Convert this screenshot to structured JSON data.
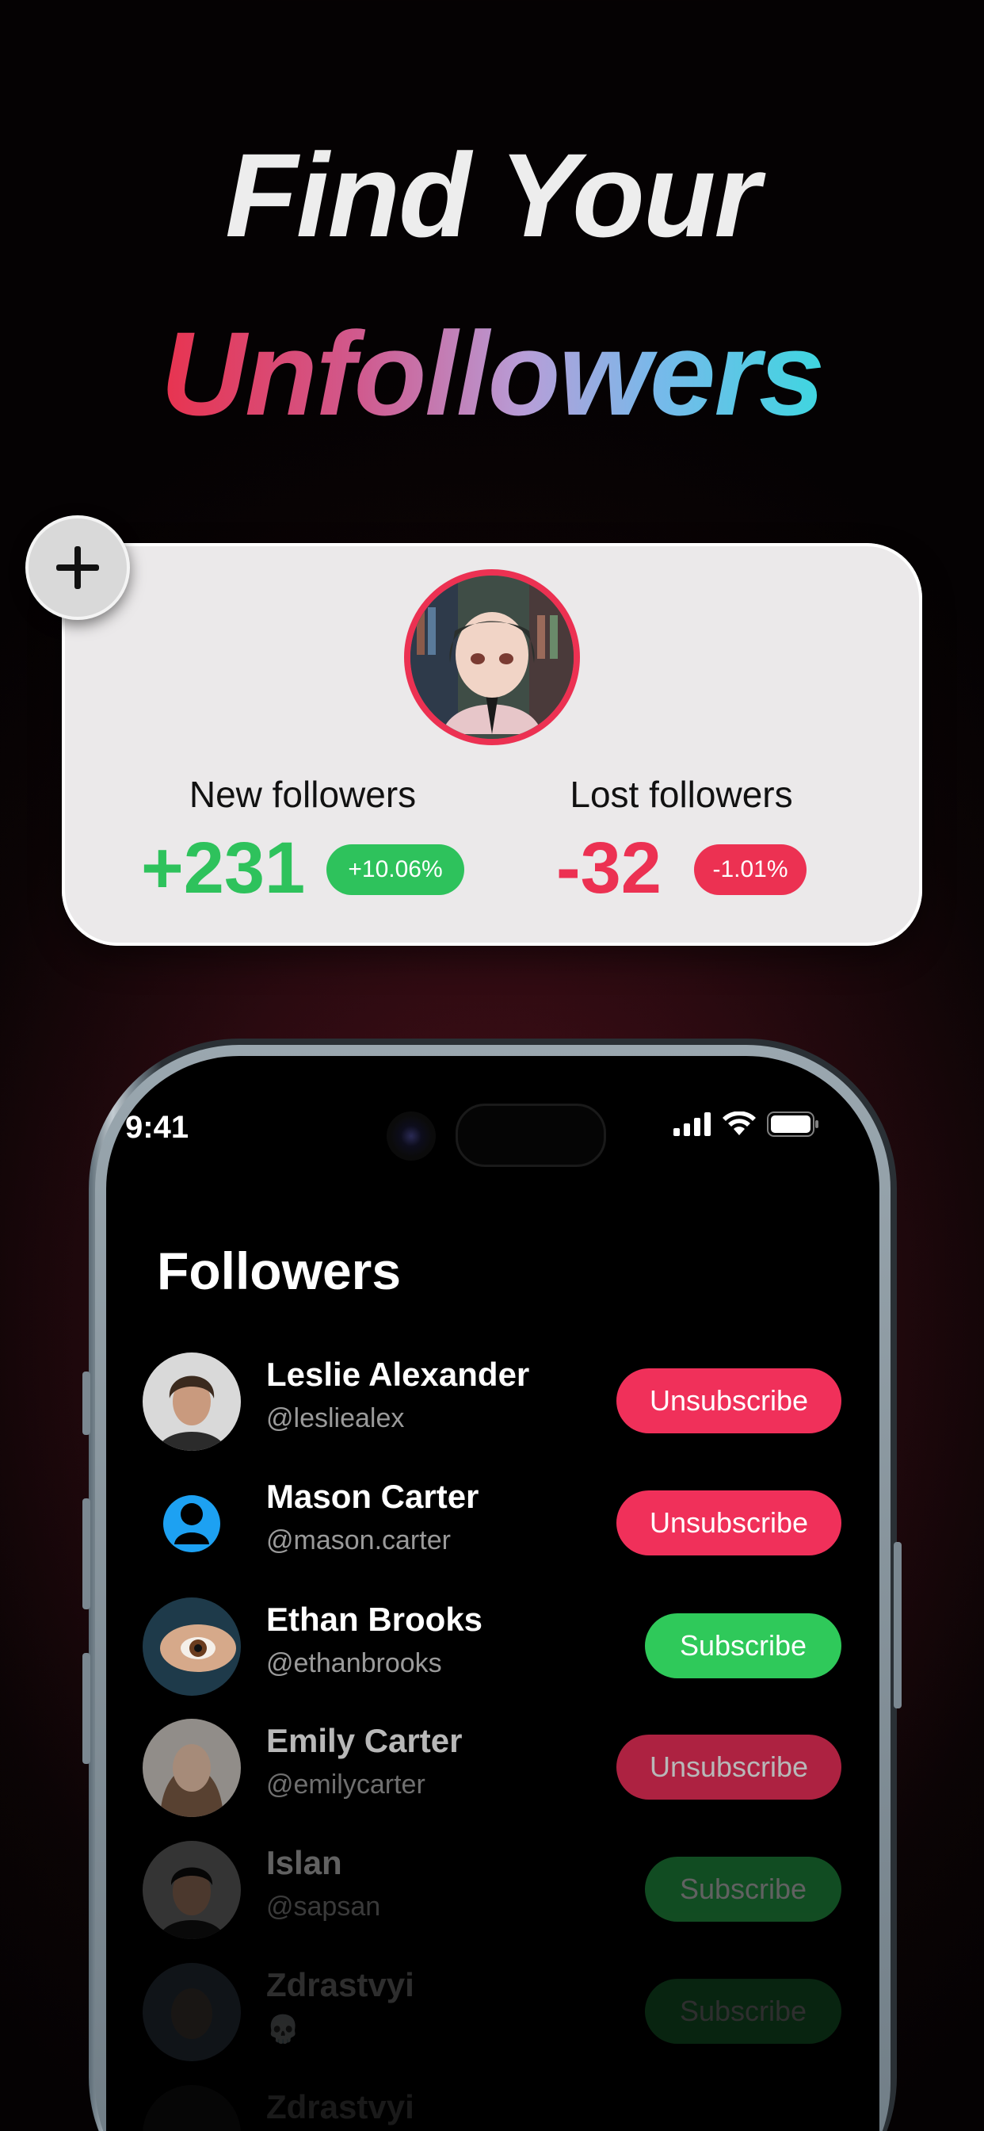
{
  "headline": {
    "line1": "Find Your",
    "line2": "Unfollowers"
  },
  "stats": {
    "new_label": "New followers",
    "new_value": "+231",
    "new_change": "+10.06%",
    "lost_label": "Lost followers",
    "lost_value": "-32",
    "lost_change": "-1.01%"
  },
  "status_bar": {
    "time": "9:41"
  },
  "followers": {
    "title": "Followers",
    "rows": [
      {
        "name": "Leslie Alexander",
        "handle": "@lesliealex",
        "action": "Unsubscribe"
      },
      {
        "name": "Mason Carter",
        "handle": "@mason.carter",
        "action": "Unsubscribe"
      },
      {
        "name": "Ethan Brooks",
        "handle": "@ethanbrooks",
        "action": "Subscribe"
      },
      {
        "name": "Emily Carter",
        "handle": "@emilycarter",
        "action": "Unsubscribe"
      },
      {
        "name": "Islan",
        "handle": "@sapsan",
        "action": "Subscribe"
      },
      {
        "name": "Zdrastvyi",
        "handle": "💀",
        "action": "Subscribe"
      },
      {
        "name": "Zdrastvyi",
        "handle": "",
        "action": ""
      }
    ]
  },
  "colors": {
    "accent_red": "#ec3152",
    "accent_green": "#2ec25c",
    "card_bg": "#ebe9ea"
  },
  "icons": {
    "add": "plus-icon",
    "signal": "cellular-signal-icon",
    "wifi": "wifi-icon",
    "battery": "battery-icon",
    "default_avatar": "person-silhouette-icon"
  }
}
